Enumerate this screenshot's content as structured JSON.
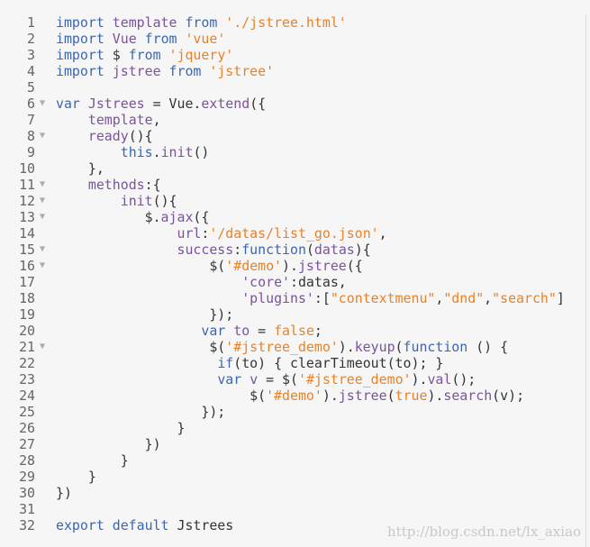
{
  "colors": {
    "keyword": "#3a66b0",
    "string": "#e8822a",
    "identifier": "#7b529c",
    "text": "#333333",
    "background": "#f6f6f6"
  },
  "fold_icon": "triangle-down-icon",
  "lines": [
    {
      "n": "1",
      "fold": false,
      "t": [
        [
          "k",
          "import "
        ],
        [
          "p",
          "template "
        ],
        [
          "k",
          "from "
        ],
        [
          "s",
          "'./jstree.html'"
        ]
      ]
    },
    {
      "n": "2",
      "fold": false,
      "t": [
        [
          "k",
          "import "
        ],
        [
          "p",
          "Vue "
        ],
        [
          "k",
          "from "
        ],
        [
          "s",
          "'vue'"
        ]
      ]
    },
    {
      "n": "3",
      "fold": false,
      "t": [
        [
          "k",
          "import "
        ],
        [
          "d",
          "$ "
        ],
        [
          "k",
          "from "
        ],
        [
          "s",
          "'jquery'"
        ]
      ]
    },
    {
      "n": "4",
      "fold": false,
      "t": [
        [
          "k",
          "import "
        ],
        [
          "p",
          "jstree "
        ],
        [
          "k",
          "from "
        ],
        [
          "s",
          "'jstree'"
        ]
      ]
    },
    {
      "n": "5",
      "fold": false,
      "t": []
    },
    {
      "n": "6",
      "fold": true,
      "t": [
        [
          "k",
          "var "
        ],
        [
          "p",
          "Jstrees "
        ],
        [
          "d",
          "= Vue."
        ],
        [
          "p",
          "extend"
        ],
        [
          "d",
          "({"
        ]
      ]
    },
    {
      "n": "7",
      "fold": false,
      "t": [
        [
          "d",
          "    "
        ],
        [
          "p",
          "template"
        ],
        [
          "d",
          ","
        ]
      ]
    },
    {
      "n": "8",
      "fold": true,
      "t": [
        [
          "d",
          "    "
        ],
        [
          "p",
          "ready"
        ],
        [
          "d",
          "(){"
        ]
      ]
    },
    {
      "n": "9",
      "fold": false,
      "t": [
        [
          "d",
          "        "
        ],
        [
          "k",
          "this"
        ],
        [
          "d",
          "."
        ],
        [
          "p",
          "init"
        ],
        [
          "d",
          "()"
        ]
      ]
    },
    {
      "n": "10",
      "fold": false,
      "t": [
        [
          "d",
          "    },"
        ]
      ]
    },
    {
      "n": "11",
      "fold": true,
      "t": [
        [
          "d",
          "    "
        ],
        [
          "p",
          "methods"
        ],
        [
          "d",
          ":{"
        ]
      ]
    },
    {
      "n": "12",
      "fold": true,
      "t": [
        [
          "d",
          "        "
        ],
        [
          "p",
          "init"
        ],
        [
          "d",
          "(){"
        ]
      ]
    },
    {
      "n": "13",
      "fold": true,
      "t": [
        [
          "d",
          "           $."
        ],
        [
          "p",
          "ajax"
        ],
        [
          "d",
          "({"
        ]
      ]
    },
    {
      "n": "14",
      "fold": false,
      "t": [
        [
          "d",
          "               "
        ],
        [
          "p",
          "url"
        ],
        [
          "d",
          ":"
        ],
        [
          "s",
          "'/datas/list_go.json'"
        ],
        [
          "d",
          ","
        ]
      ]
    },
    {
      "n": "15",
      "fold": true,
      "t": [
        [
          "d",
          "               "
        ],
        [
          "p",
          "success"
        ],
        [
          "d",
          ":"
        ],
        [
          "k",
          "function"
        ],
        [
          "d",
          "("
        ],
        [
          "p",
          "datas"
        ],
        [
          "d",
          "){"
        ]
      ]
    },
    {
      "n": "16",
      "fold": true,
      "t": [
        [
          "d",
          "                   $("
        ],
        [
          "s",
          "'#demo'"
        ],
        [
          "d",
          ")."
        ],
        [
          "p",
          "jstree"
        ],
        [
          "d",
          "({"
        ]
      ]
    },
    {
      "n": "17",
      "fold": false,
      "t": [
        [
          "d",
          "                       "
        ],
        [
          "p",
          "'core'"
        ],
        [
          "d",
          ":datas,"
        ]
      ]
    },
    {
      "n": "18",
      "fold": false,
      "t": [
        [
          "d",
          "                       "
        ],
        [
          "p",
          "'plugins'"
        ],
        [
          "d",
          ":["
        ],
        [
          "s",
          "\"contextmenu\""
        ],
        [
          "d",
          ","
        ],
        [
          "s",
          "\"dnd\""
        ],
        [
          "d",
          ","
        ],
        [
          "s",
          "\"search\""
        ],
        [
          "d",
          "]"
        ]
      ]
    },
    {
      "n": "19",
      "fold": false,
      "t": [
        [
          "d",
          "                   });"
        ]
      ]
    },
    {
      "n": "20",
      "fold": false,
      "t": [
        [
          "d",
          "                  "
        ],
        [
          "k",
          "var "
        ],
        [
          "p",
          "to "
        ],
        [
          "d",
          "= "
        ],
        [
          "s",
          "false"
        ],
        [
          "d",
          ";"
        ]
      ]
    },
    {
      "n": "21",
      "fold": true,
      "t": [
        [
          "d",
          "                   $("
        ],
        [
          "s",
          "'#jstree_demo'"
        ],
        [
          "d",
          ")."
        ],
        [
          "p",
          "keyup"
        ],
        [
          "d",
          "("
        ],
        [
          "k",
          "function "
        ],
        [
          "d",
          "() {"
        ]
      ]
    },
    {
      "n": "22",
      "fold": false,
      "t": [
        [
          "d",
          "                    "
        ],
        [
          "k",
          "if"
        ],
        [
          "d",
          "(to) { clearTimeout(to); }"
        ]
      ]
    },
    {
      "n": "23",
      "fold": false,
      "t": [
        [
          "d",
          "                    "
        ],
        [
          "k",
          "var "
        ],
        [
          "p",
          "v "
        ],
        [
          "d",
          "= $("
        ],
        [
          "s",
          "'#jstree_demo'"
        ],
        [
          "d",
          ")."
        ],
        [
          "p",
          "val"
        ],
        [
          "d",
          "();"
        ]
      ]
    },
    {
      "n": "24",
      "fold": false,
      "t": [
        [
          "d",
          "                        $("
        ],
        [
          "s",
          "'#demo'"
        ],
        [
          "d",
          ")."
        ],
        [
          "p",
          "jstree"
        ],
        [
          "d",
          "("
        ],
        [
          "s",
          "true"
        ],
        [
          "d",
          ")."
        ],
        [
          "p",
          "search"
        ],
        [
          "d",
          "(v);"
        ]
      ]
    },
    {
      "n": "25",
      "fold": false,
      "t": [
        [
          "d",
          "                  });"
        ]
      ]
    },
    {
      "n": "26",
      "fold": false,
      "t": [
        [
          "d",
          "               }"
        ]
      ]
    },
    {
      "n": "27",
      "fold": false,
      "t": [
        [
          "d",
          "           })"
        ]
      ]
    },
    {
      "n": "28",
      "fold": false,
      "t": [
        [
          "d",
          "        }"
        ]
      ]
    },
    {
      "n": "29",
      "fold": false,
      "t": [
        [
          "d",
          "    }"
        ]
      ]
    },
    {
      "n": "30",
      "fold": false,
      "t": [
        [
          "d",
          "})"
        ]
      ]
    },
    {
      "n": "31",
      "fold": false,
      "t": []
    },
    {
      "n": "32",
      "fold": false,
      "t": [
        [
          "k",
          "export default "
        ],
        [
          "d",
          "Jstrees"
        ]
      ]
    }
  ],
  "watermark": "http://blog.csdn.net/lx_axiao"
}
